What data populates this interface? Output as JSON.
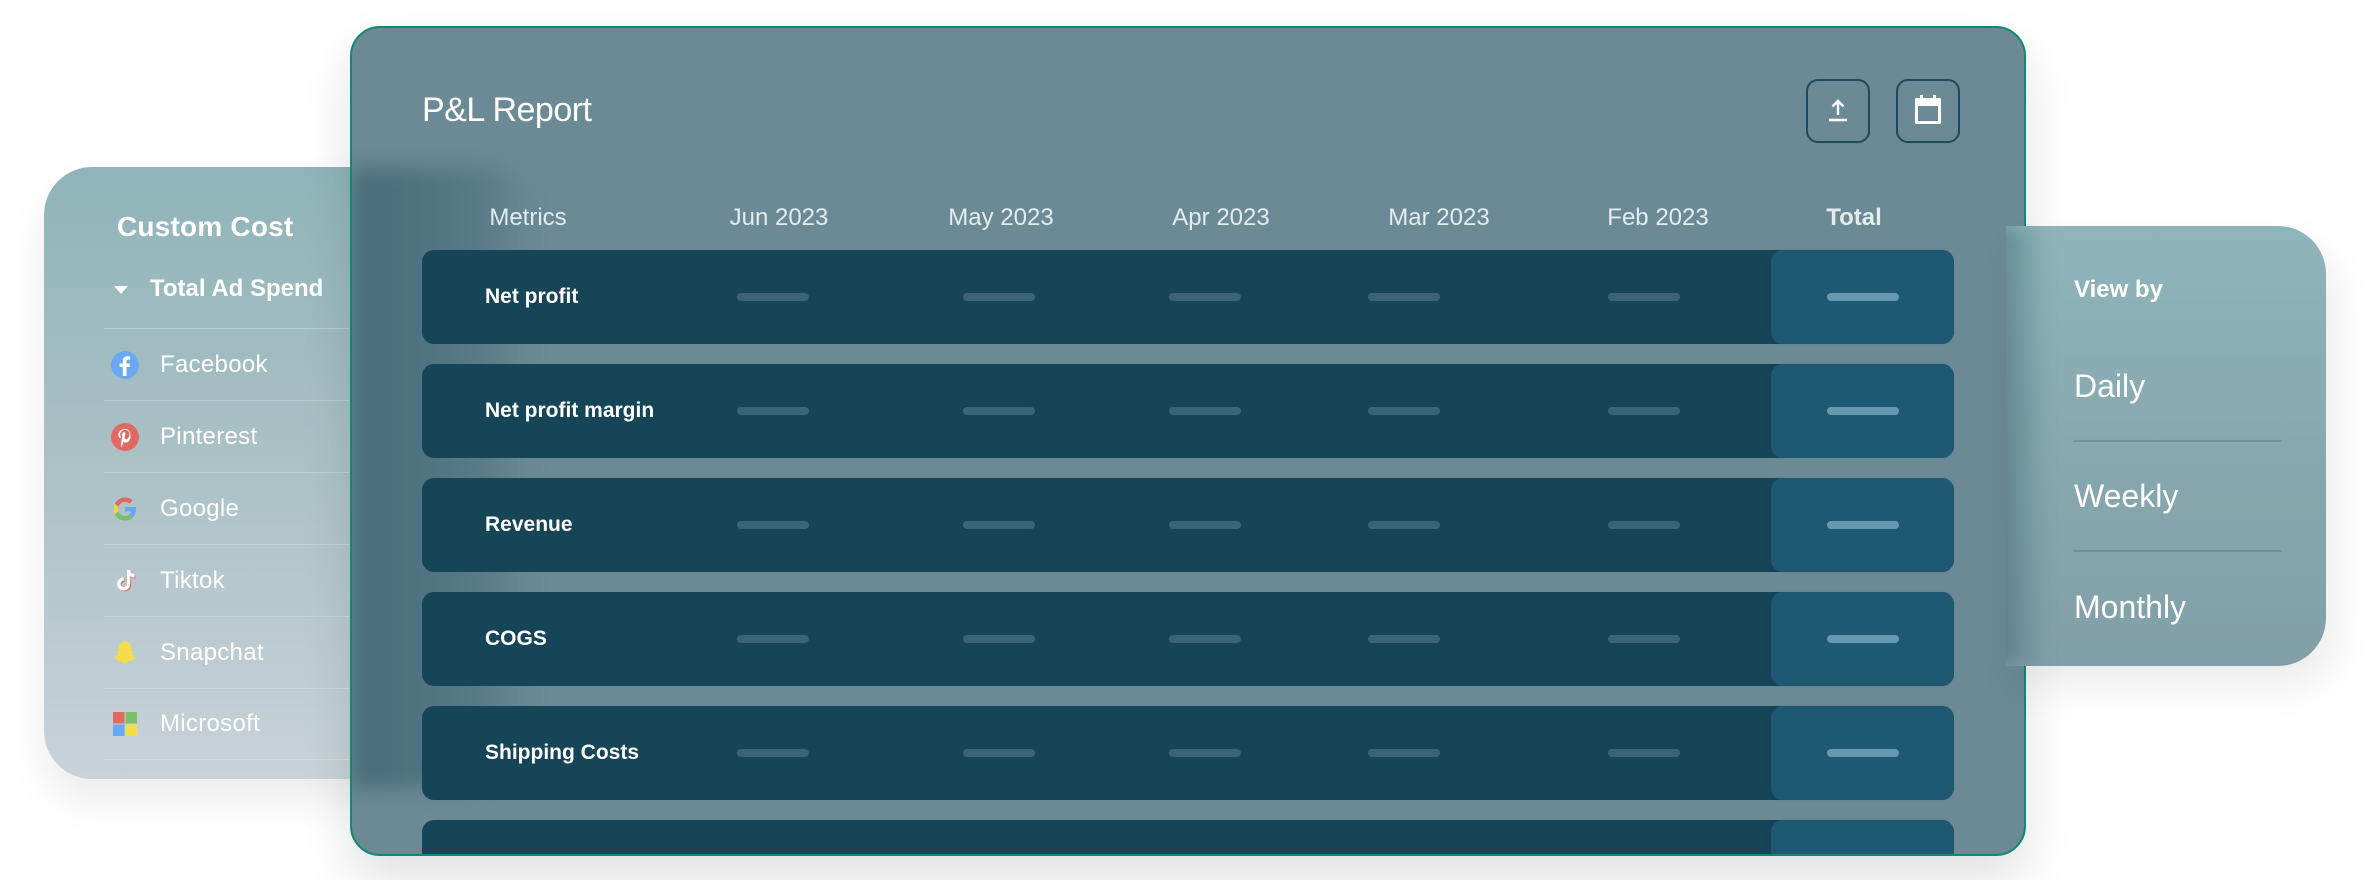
{
  "custom_cost": {
    "title": "Custom Cost",
    "group_label": "Total Ad Spend",
    "items": [
      {
        "label": "Facebook",
        "icon": "facebook-icon"
      },
      {
        "label": "Pinterest",
        "icon": "pinterest-icon"
      },
      {
        "label": "Google",
        "icon": "google-icon"
      },
      {
        "label": "Tiktok",
        "icon": "tiktok-icon"
      },
      {
        "label": "Snapchat",
        "icon": "snapchat-icon"
      },
      {
        "label": "Microsoft",
        "icon": "microsoft-icon"
      }
    ]
  },
  "pnl": {
    "title": "P&L Report",
    "actions": {
      "export_icon": "upload-icon",
      "calendar_icon": "calendar-icon"
    },
    "columns": [
      "Metrics",
      "Jun 2023",
      "May 2023",
      "Apr 2023",
      "Mar 2023",
      "Feb 2023",
      "Total"
    ],
    "rows": [
      {
        "metric": "Net profit"
      },
      {
        "metric": "Net profit margin"
      },
      {
        "metric": "Revenue"
      },
      {
        "metric": "COGS"
      },
      {
        "metric": "Shipping Costs"
      },
      {
        "metric": ""
      }
    ],
    "colors": {
      "accent_border": "#0f8a6c",
      "row_bg": "#174558",
      "total_bg": "#1f5873"
    }
  },
  "view_by": {
    "title": "View by",
    "options": [
      "Daily",
      "Weekly",
      "Monthly"
    ]
  }
}
